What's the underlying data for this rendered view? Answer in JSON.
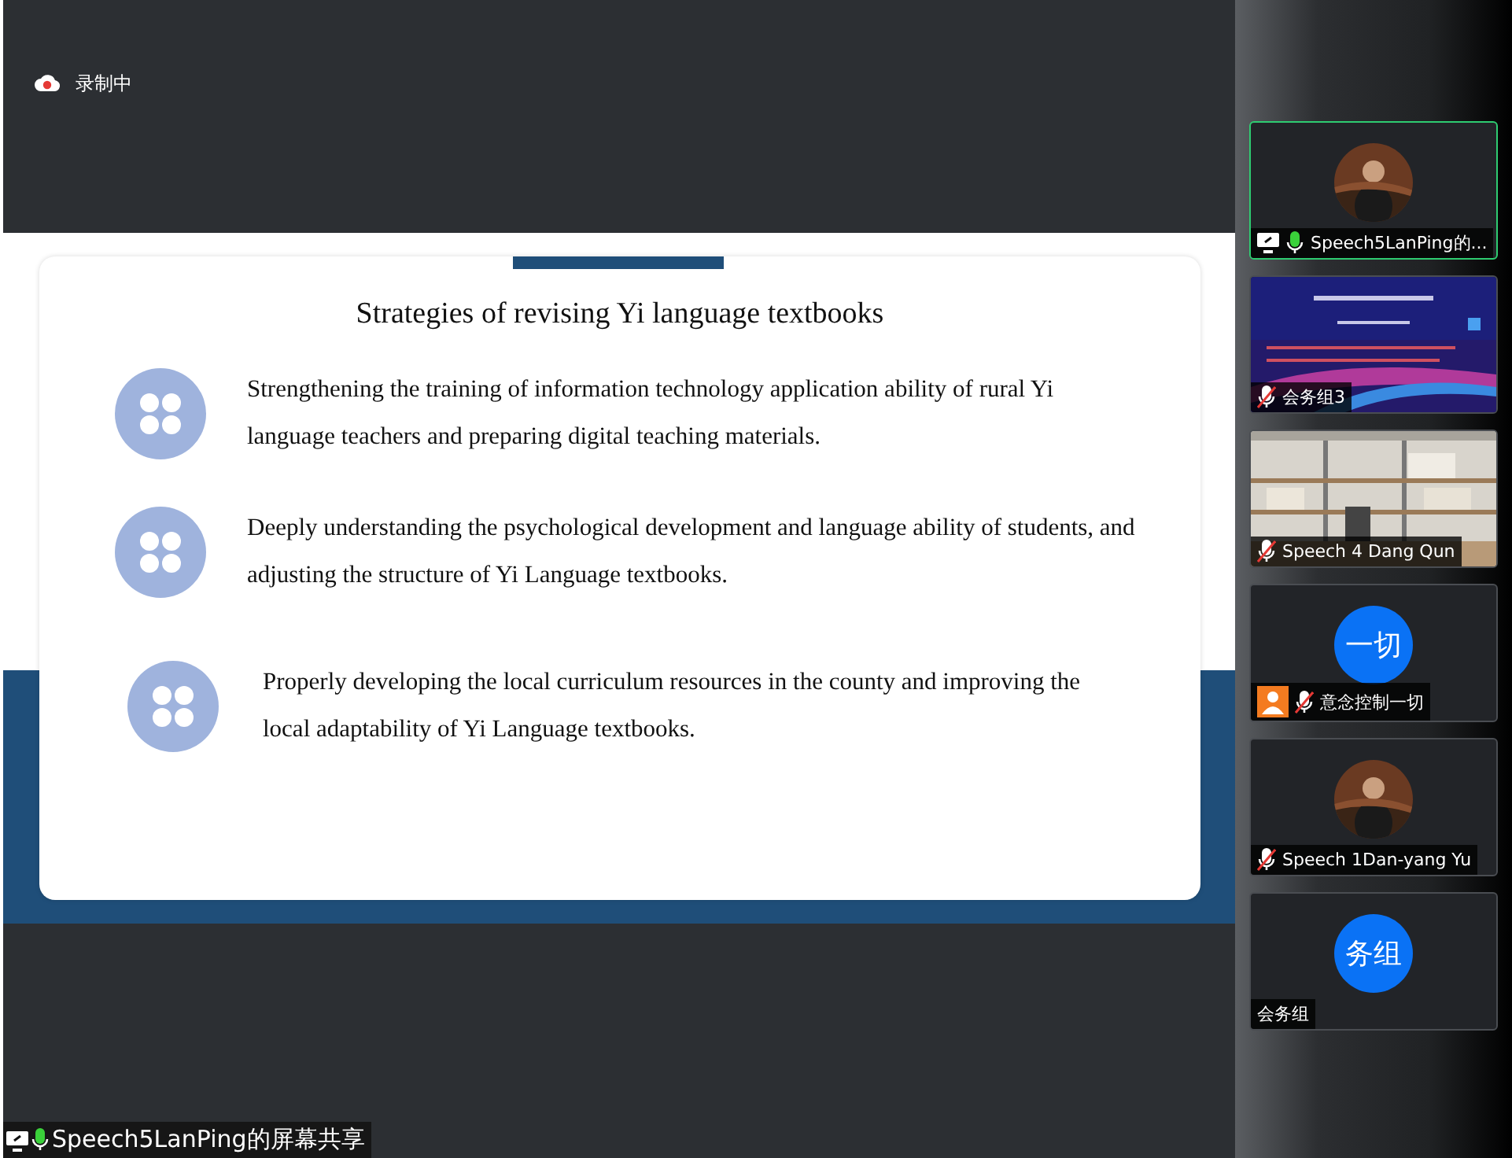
{
  "recording": {
    "label": "录制中"
  },
  "slide": {
    "title": "Strategies of revising Yi language textbooks",
    "points": [
      {
        "text": "Strengthening the training of information technology application ability of rural Yi language teachers and preparing digital teaching materials."
      },
      {
        "text": "Deeply understanding the psychological development and language ability of students, and adjusting the structure of Yi Language textbooks."
      },
      {
        "text": "Properly developing the local curriculum resources in the county and improving the local adaptability of Yi Language textbooks."
      }
    ]
  },
  "participants": [
    {
      "name": "Speech5LanPing的...",
      "kind": "photo-avatar",
      "muted": false,
      "sharing": true,
      "selected": true
    },
    {
      "name": "会务组3",
      "kind": "screen",
      "muted": true,
      "selected": false
    },
    {
      "name": "Speech 4 Dang Qun",
      "kind": "video",
      "muted": true,
      "selected": false
    },
    {
      "name": "意念控制一切",
      "kind": "initials",
      "initials": "一切",
      "muted": true,
      "host": true,
      "selected": false
    },
    {
      "name": "Speech 1Dan-yang Yu",
      "kind": "photo-avatar",
      "muted": true,
      "selected": false
    },
    {
      "name": "会务组",
      "kind": "initials",
      "initials": "务组",
      "selected": false
    }
  ],
  "share_banner": {
    "label": "Speech5LanPing的屏幕共享",
    "muted": false,
    "sharing": true
  }
}
